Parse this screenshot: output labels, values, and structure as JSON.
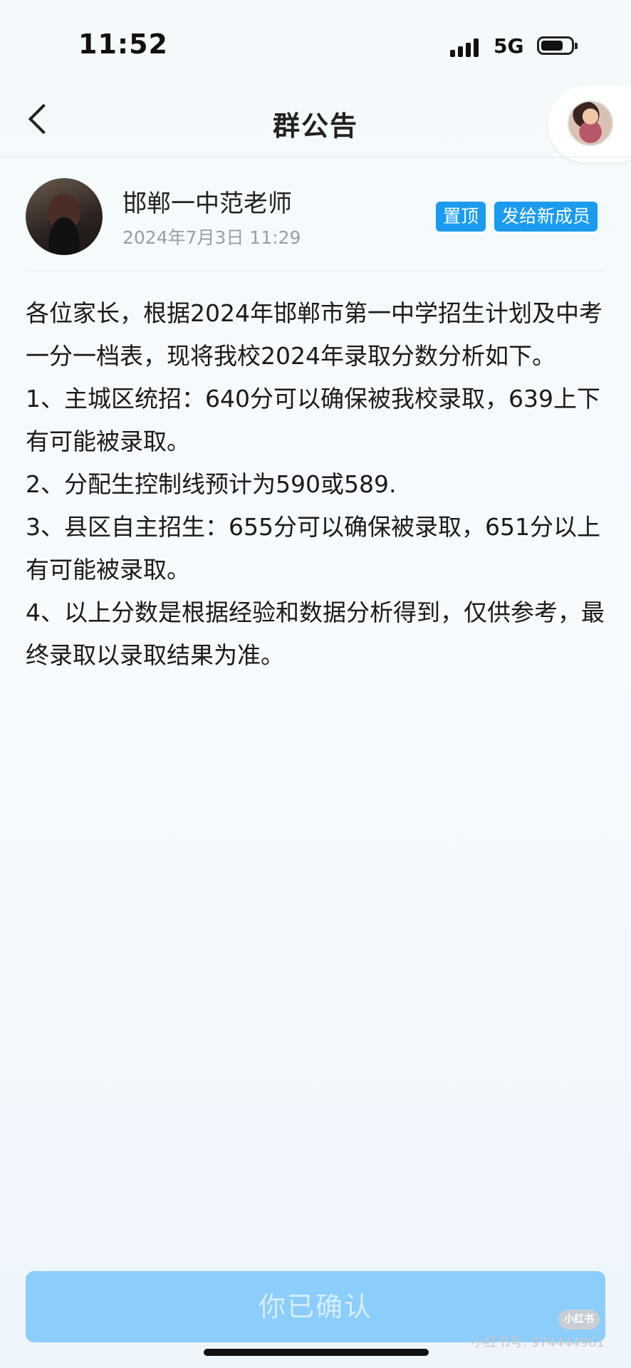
{
  "status_bar": {
    "time": "11:52",
    "network": "5G"
  },
  "header": {
    "title": "群公告"
  },
  "author": {
    "name": "邯郸一中范老师",
    "timestamp": "2024年7月3日 11:29"
  },
  "tags": {
    "pin": "置顶",
    "send_new_members": "发给新成员"
  },
  "announcement": {
    "paragraphs": [
      "各位家长，根据2024年邯郸市第一中学招生计划及中考一分一档表，现将我校2024年录取分数分析如下。",
      "1、主城区统招：640分可以确保被我校录取，639上下有可能被录取。",
      "2、分配生控制线预计为590或589.",
      "3、县区自主招生：655分可以确保被录取，651分以上有可能被录取。",
      "4、以上分数是根据经验和数据分析得到，仅供参考，最终录取以录取结果为准。"
    ]
  },
  "confirm_button": {
    "label": "你已确认"
  },
  "watermark": {
    "logo": "小红书",
    "id_text": "小红书号: 974444961"
  }
}
